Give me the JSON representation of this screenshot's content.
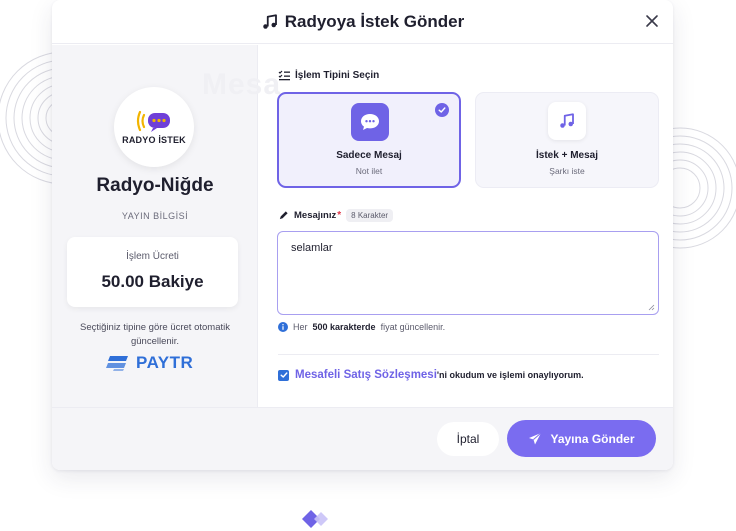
{
  "modal": {
    "title": "Radyoya İstek Gönder",
    "close_icon": "close-icon",
    "title_icon": "music-note-icon"
  },
  "left_panel": {
    "watermark": "Mesa",
    "logo_text": "RADYO İSTEK",
    "station_name": "Radyo-Niğde",
    "broadcast_info": "YAYIN BİLGİSİ",
    "fee_label": "İşlem Ücreti",
    "fee_value": "50.00 Bakiye",
    "fee_note": "Seçtiğiniz tipine göre ücret otomatik güncellenir.",
    "payment_provider": "PAYTR"
  },
  "form": {
    "section_title": "İşlem Tipini Seçin",
    "types": [
      {
        "title": "Sadece Mesaj",
        "subtitle": "Not ilet",
        "icon": "chat-bubble-icon",
        "selected": true
      },
      {
        "title": "İstek + Mesaj",
        "subtitle": "Şarkı iste",
        "icon": "music-note-icon",
        "selected": false
      }
    ],
    "message_label": "Mesajınız",
    "required_mark": "*",
    "char_count": "8 Karakter",
    "message_value": "selamlar",
    "info_prefix": "Her",
    "info_bold": "500 karakterde",
    "info_suffix": "fiyat güncellenir.",
    "agreement_link": "Mesafeli Satış Sözleşmesi",
    "agreement_text": "'ni okudum ve işlemi onaylıyorum.",
    "agreement_checked": true
  },
  "footer": {
    "cancel_label": "İptal",
    "send_label": "Yayına Gönder",
    "send_icon": "send-icon"
  },
  "colors": {
    "accent": "#7a6cf0",
    "accent_dark": "#6f63e6",
    "link_blue": "#2f6fd8",
    "panel_bg": "#f5f5f8"
  }
}
